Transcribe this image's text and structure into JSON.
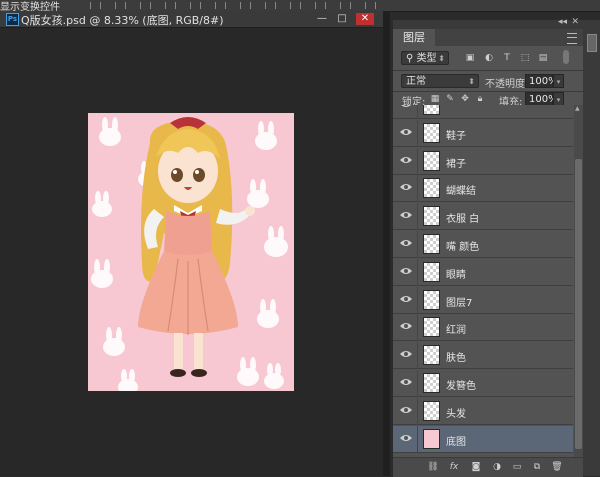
{
  "options_bar": {
    "label": "显示变换控件"
  },
  "document": {
    "title": "Q版女孩.psd @ 8.33% (底图, RGB/8#)",
    "app_icon": "Ps",
    "minimize": "—",
    "restore": "□",
    "close": "✕"
  },
  "panel": {
    "collapse_arrows": "◂◂",
    "close": "✕",
    "tab_label": "图层",
    "filter_type": "类型",
    "blend_mode": "正常",
    "opacity_label": "不透明度:",
    "opacity_value": "100%",
    "lock_label": "锁定:",
    "fill_label": "填充:",
    "fill_value": "100%",
    "filter_icons": [
      "image-filter-icon",
      "adjustment-filter-icon",
      "text-filter-icon",
      "shape-filter-icon",
      "smartobject-filter-icon"
    ],
    "lock_icons": [
      "lock-pixels-icon",
      "lock-paint-icon",
      "lock-position-icon",
      "lock-all-icon"
    ]
  },
  "layers": [
    {
      "name": "",
      "partial": true
    },
    {
      "name": "鞋子"
    },
    {
      "name": "裙子"
    },
    {
      "name": "蝴蝶结"
    },
    {
      "name": "衣服 白"
    },
    {
      "name": "嘴 颜色"
    },
    {
      "name": "眼睛"
    },
    {
      "name": "图层7"
    },
    {
      "name": "红润"
    },
    {
      "name": "肤色"
    },
    {
      "name": "发簪色"
    },
    {
      "name": "头发"
    },
    {
      "name": "底图",
      "active": true
    }
  ],
  "footer_icons": [
    "link-icon",
    "fx-icon",
    "mask-icon",
    "adjustment-icon",
    "group-folder-icon",
    "new-layer-icon",
    "trash-icon"
  ],
  "colors": {
    "canvas_bg": "#f7c8d2",
    "accent": "#5b6677"
  }
}
